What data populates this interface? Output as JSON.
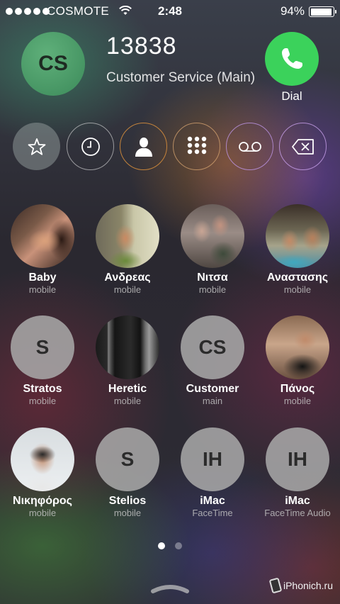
{
  "status_bar": {
    "carrier": "COSMOTE",
    "time": "2:48",
    "battery_percent": "94%",
    "battery_level": 0.94,
    "signal_bars": 5
  },
  "header": {
    "avatar_initials": "CS",
    "number": "13838",
    "label": "Customer Service (Main)",
    "dial_label": "Dial",
    "dial_color": "#3bd25b"
  },
  "actions": [
    {
      "icon": "star-icon"
    },
    {
      "icon": "clock-icon"
    },
    {
      "icon": "person-icon"
    },
    {
      "icon": "keypad-icon"
    },
    {
      "icon": "voicemail-icon"
    },
    {
      "icon": "backspace-icon"
    }
  ],
  "contacts": [
    {
      "name": "Baby",
      "sub": "mobile",
      "initials": ""
    },
    {
      "name": "Ανδρεας",
      "sub": "mobile",
      "initials": ""
    },
    {
      "name": "Νιτσα",
      "sub": "mobile",
      "initials": ""
    },
    {
      "name": "Αναστασης",
      "sub": "mobile",
      "initials": ""
    },
    {
      "name": "Stratos",
      "sub": "mobile",
      "initials": "S"
    },
    {
      "name": "Heretic",
      "sub": "mobile",
      "initials": ""
    },
    {
      "name": "Customer",
      "sub": "main",
      "initials": "CS"
    },
    {
      "name": "Πάνος",
      "sub": "mobile",
      "initials": ""
    },
    {
      "name": "Νικηφόρος",
      "sub": "mobile",
      "initials": ""
    },
    {
      "name": "Stelios",
      "sub": "mobile",
      "initials": "S"
    },
    {
      "name": "iMac",
      "sub": "FaceTime",
      "initials": "IH"
    },
    {
      "name": "iMac",
      "sub": "FaceTime Audio",
      "initials": "IH"
    }
  ],
  "pages": {
    "count": 2,
    "current": 1
  },
  "watermark": "iPhonich.ru"
}
